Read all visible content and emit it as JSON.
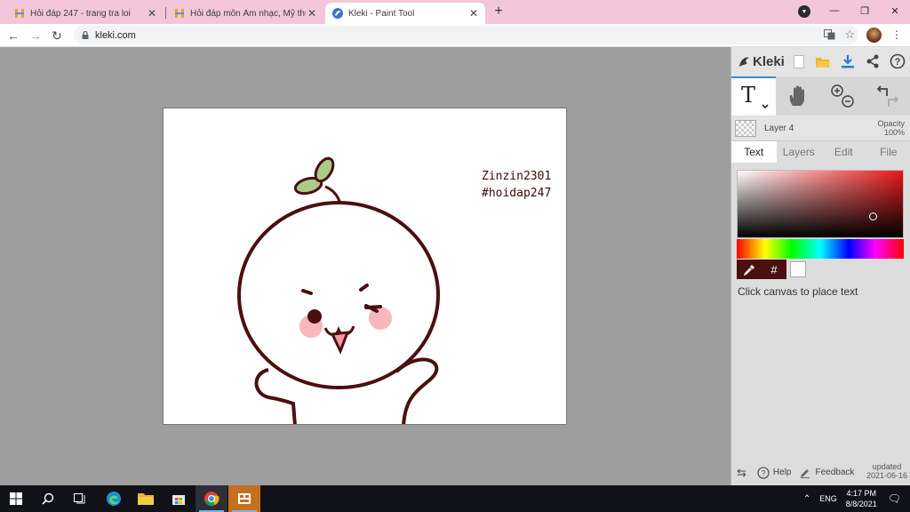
{
  "browser": {
    "tabs": [
      {
        "title": "Hỏi đáp 247 - trang tra loi",
        "favicon": "hoidap-logo-icon",
        "active": false
      },
      {
        "title": "Hỏi đáp môn Âm nhạc, Mỹ thuật",
        "favicon": "hoidap-logo-icon",
        "active": false
      },
      {
        "title": "Kleki - Paint Tool",
        "favicon": "kleki-logo-icon",
        "active": true
      }
    ],
    "url": "kleki.com"
  },
  "canvas": {
    "text_line1": "Zinzin2301",
    "text_line2": "#hoidap247"
  },
  "panel": {
    "logo": "Kleki",
    "layer_name": "Layer 4",
    "opacity_label": "Opacity",
    "opacity_value": "100%",
    "tabs": [
      "Text",
      "Layers",
      "Edit",
      "File"
    ],
    "hex_label": "#",
    "hint": "Click canvas to place text",
    "footer": {
      "help": "Help",
      "feedback": "Feedback",
      "updated_label": "updated",
      "updated_date": "2021-06-16"
    }
  },
  "taskbar": {
    "language": "ENG",
    "time": "4:17 PM",
    "date": "8/8/2021"
  },
  "colors": {
    "tab_strip": "#f3c7d9",
    "workspace": "#9e9e9e",
    "ink": "#4a0f0f"
  }
}
